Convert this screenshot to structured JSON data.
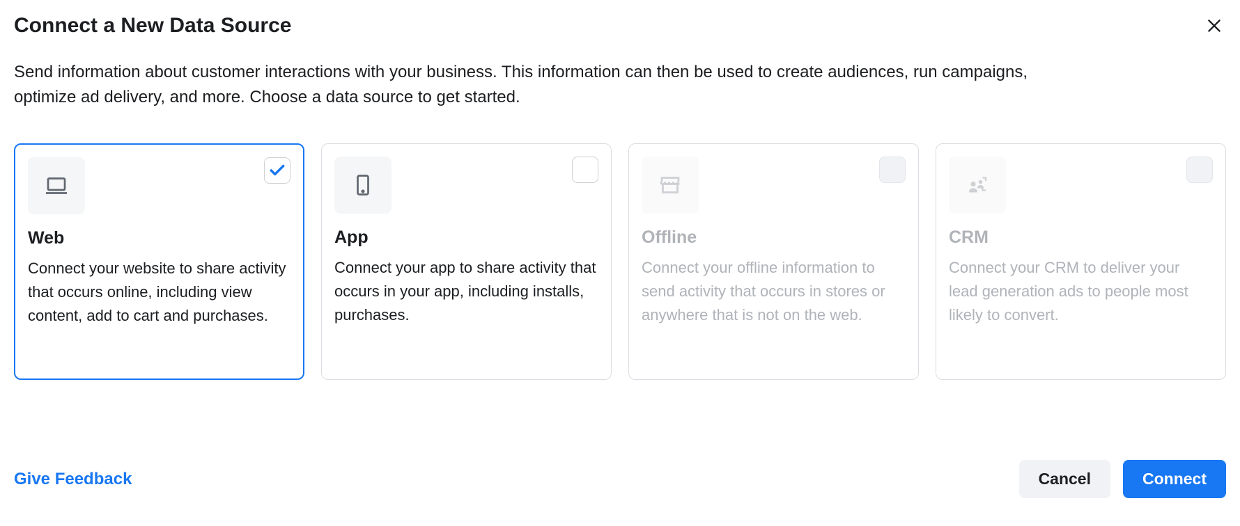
{
  "header": {
    "title": "Connect a New Data Source"
  },
  "description": "Send information about customer interactions with your business. This information can then be used to create audiences, run campaigns, optimize ad delivery, and more. Choose a data source to get started.",
  "cards": {
    "web": {
      "title": "Web",
      "desc": "Connect your website to share activity that occurs online, including view content, add to cart and purchases."
    },
    "app": {
      "title": "App",
      "desc": "Connect your app to share activity that occurs in your app, including installs, purchases."
    },
    "offline": {
      "title": "Offline",
      "desc": "Connect your offline information to send activity that occurs in stores or anywhere that is not on the web."
    },
    "crm": {
      "title": "CRM",
      "desc": "Connect your CRM to deliver your lead generation ads to people most likely to convert."
    }
  },
  "footer": {
    "feedback": "Give Feedback",
    "cancel": "Cancel",
    "connect": "Connect"
  }
}
